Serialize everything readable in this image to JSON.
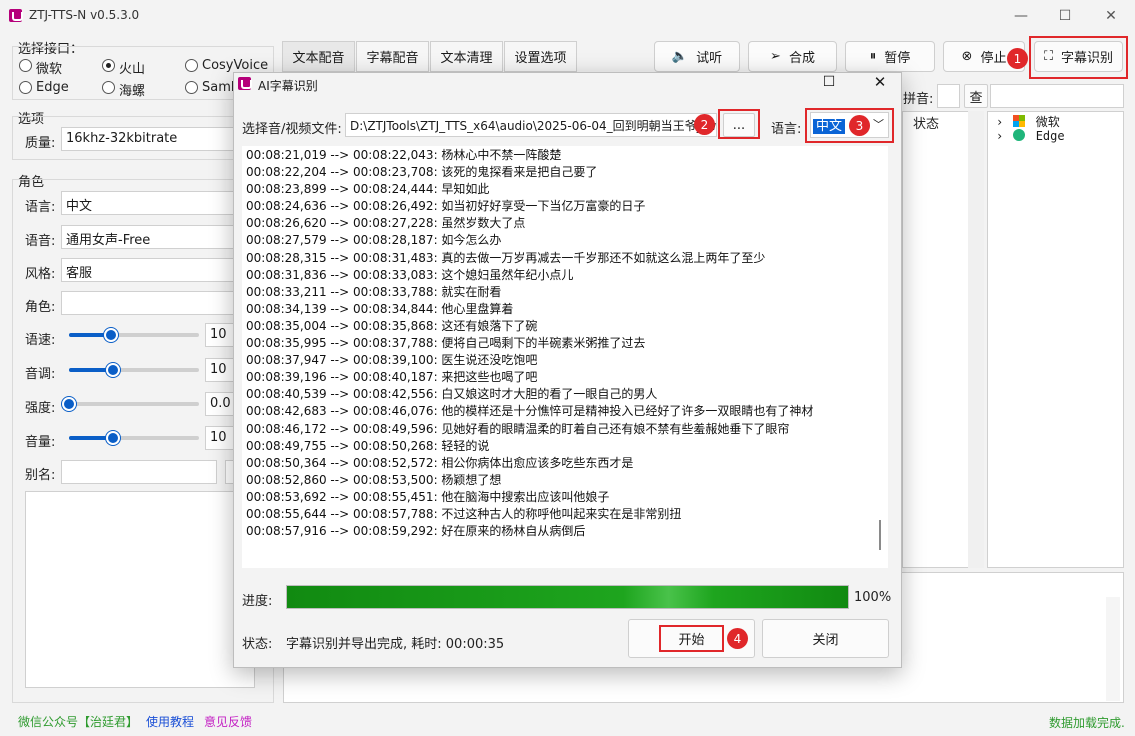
{
  "window": {
    "title": "ZTJ-TTS-N v0.5.3.0",
    "min": "—",
    "max": "☐",
    "close": "✕"
  },
  "left": {
    "interface_group_title": "选择接口：",
    "engines": [
      {
        "label": "微软",
        "selected": false
      },
      {
        "label": "火山",
        "selected": true
      },
      {
        "label": "CosyVoice",
        "selected": false
      },
      {
        "label": "Edge",
        "selected": false
      },
      {
        "label": "海螺",
        "selected": false
      },
      {
        "label": "Samb",
        "selected": false
      }
    ],
    "options_title": "选项",
    "quality_label": "质量:",
    "quality_value": "16khz-32kbitrate",
    "role_title": "角色",
    "language_label": "语言:",
    "language_value": "中文",
    "voice_label": "语音:",
    "voice_value": "通用女声-Free",
    "style_label": "风格:",
    "style_value": "客服",
    "character_label": "角色:",
    "character_value": "",
    "speed_label": "语速:",
    "speed_value": "10",
    "speed_level": 0.32,
    "pitch_label": "音调:",
    "pitch_value": "10",
    "pitch_level": 0.34,
    "intensity_label": "强度:",
    "intensity_value": "0.0",
    "intensity_level": 0.0,
    "volume_label": "音量:",
    "volume_value": "10",
    "volume_level": 0.34,
    "alias_label": "别名:",
    "alias_value": ""
  },
  "tabs": [
    {
      "label": "文本配音",
      "active": true
    },
    {
      "label": "字幕配音",
      "active": false
    },
    {
      "label": "文本清理",
      "active": false
    },
    {
      "label": "设置选项",
      "active": false
    }
  ],
  "toolbar": {
    "listen": "试听",
    "synthesize": "合成",
    "pause": "暂停",
    "stop": "停止",
    "subtitle_recognition": "字幕识别"
  },
  "right_panel": {
    "pinyin_label": "拼音:",
    "search_button": "查",
    "status_col": "状态",
    "tree": [
      {
        "label": "微软"
      },
      {
        "label": "Edge"
      }
    ]
  },
  "footer": {
    "wechat": "微信公众号【治廷君】",
    "tutorial": "使用教程",
    "feedback": "意见反馈",
    "status": "数据加载完成."
  },
  "dialog": {
    "title": "AI字幕识别",
    "file_label": "选择音/视频文件:",
    "file_path": "D:\\ZTJTools\\ZTJ_TTS_x64\\audio\\2025-06-04_回到明朝当王爷_.wav",
    "browse_button": "...",
    "lang_label": "语言:",
    "lang_value": "中文",
    "subtitles": [
      "00:08:21,019 --> 00:08:22,043: 杨林心中不禁一阵酸楚",
      "00:08:22,204 --> 00:08:23,708: 该死的鬼探看来是把自己要了",
      "00:08:23,899 --> 00:08:24,444: 早知如此",
      "00:08:24,636 --> 00:08:26,492: 如当初好好享受一下当亿万富豪的日子",
      "00:08:26,620 --> 00:08:27,228: 虽然岁数大了点",
      "00:08:27,579 --> 00:08:28,187: 如今怎么办",
      "00:08:28,315 --> 00:08:31,483: 真的去做一万岁再减去一千岁那还不如就这么混上两年了至少",
      "00:08:31,836 --> 00:08:33,083: 这个媳妇虽然年纪小点儿",
      "00:08:33,211 --> 00:08:33,788: 就实在耐看",
      "00:08:34,139 --> 00:08:34,844: 他心里盘算着",
      "00:08:35,004 --> 00:08:35,868: 这还有娘落下了碗",
      "00:08:35,995 --> 00:08:37,788: 便将自己喝剩下的半碗素米粥推了过去",
      "00:08:37,947 --> 00:08:39,100: 医生说还没吃饱吧",
      "00:08:39,196 --> 00:08:40,187: 来把这些也喝了吧",
      "00:08:40,539 --> 00:08:42,556: 白又娘这时才大胆的看了一眼自己的男人",
      "00:08:42,683 --> 00:08:46,076: 他的模样还是十分憔悴可是精神投入已经好了许多一双眼睛也有了神材",
      "00:08:46,172 --> 00:08:49,596: 见她好看的眼睛温柔的盯着自己还有娘不禁有些羞赧她垂下了眼帘",
      "00:08:49,755 --> 00:08:50,268: 轻轻的说",
      "00:08:50,364 --> 00:08:52,572: 相公你病体出愈应该多吃些东西才是",
      "00:08:52,860 --> 00:08:53,500: 杨颖想了想",
      "00:08:53,692 --> 00:08:55,451: 他在脑海中搜索出应该叫他娘子",
      "00:08:55,644 --> 00:08:57,788: 不过这种古人的称呼他叫起来实在是非常别扭",
      "00:08:57,916 --> 00:08:59,292: 好在原来的杨林自从病倒后"
    ],
    "progress_label": "进度:",
    "progress_value": 1.0,
    "progress_text": "100%",
    "status_label": "状态:",
    "status_text": "字幕识别并导出完成, 耗时: 00:00:35",
    "start_button": "开始",
    "close_button": "关闭"
  },
  "annotations": [
    "1",
    "2",
    "3",
    "4"
  ],
  "colors": {
    "accent": "#0a5ec7",
    "annotation": "#e0272a",
    "progress": "#1ea51e",
    "status_ok": "#2f9b2f"
  }
}
